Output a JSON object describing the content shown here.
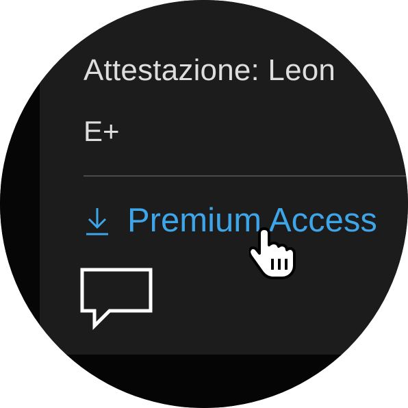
{
  "certification": {
    "label_text": "Attestazione: Leon",
    "rating": "E+"
  },
  "premium": {
    "label": "Premium Access",
    "icon": "download-icon",
    "color": "#3ea6e8"
  },
  "comment": {
    "icon": "comment-icon"
  },
  "cursor": {
    "icon": "hand-pointer-icon"
  }
}
